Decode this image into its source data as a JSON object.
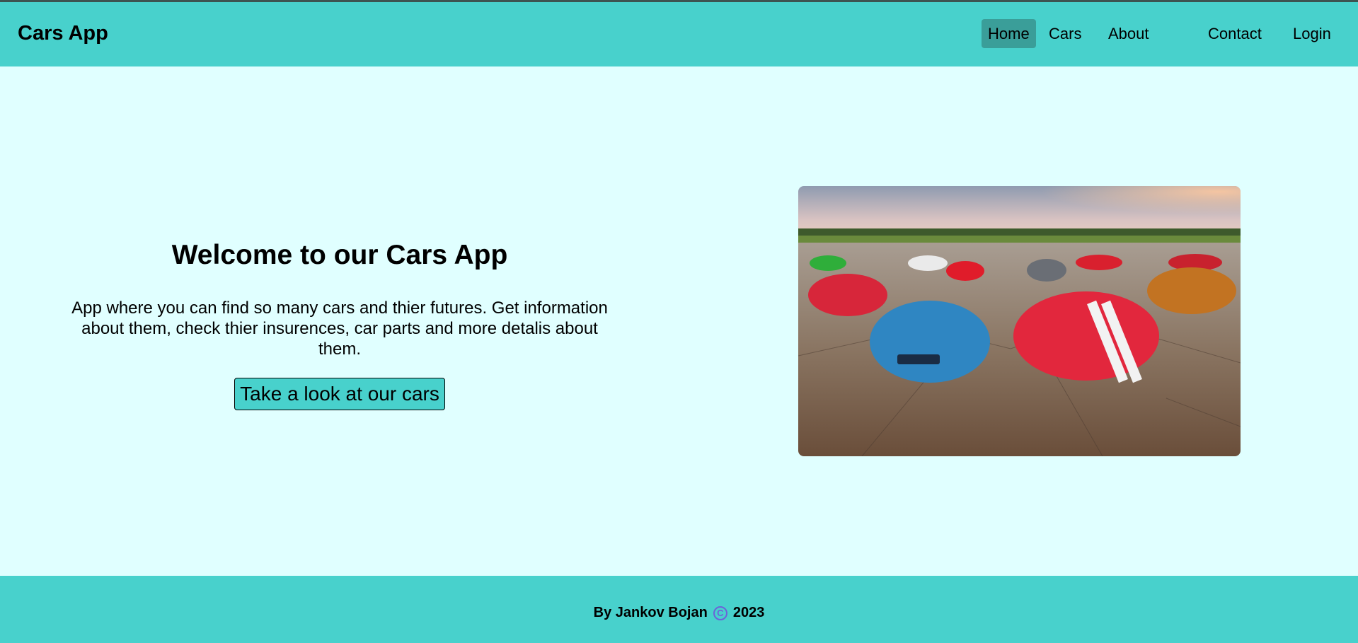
{
  "header": {
    "brand": "Cars App",
    "nav": [
      {
        "label": "Home",
        "active": true
      },
      {
        "label": "Cars",
        "active": false
      },
      {
        "label": "About",
        "active": false
      },
      {
        "label": "Contact",
        "active": false
      },
      {
        "label": "Login",
        "active": false
      }
    ]
  },
  "hero": {
    "title": "Welcome to our Cars App",
    "description": "App where you can find so many cars and thier futures. Get information about them, check thier insurences, car parts and more detalis about them.",
    "cta_label": "Take a look at our cars"
  },
  "footer": {
    "author": "By Jankov Bojan",
    "copyright_icon": "copyright-icon",
    "year": "2023"
  },
  "colors": {
    "header_bg": "#48d1cc",
    "page_bg": "#e0ffff",
    "active_nav_bg": "#3a9e99"
  }
}
